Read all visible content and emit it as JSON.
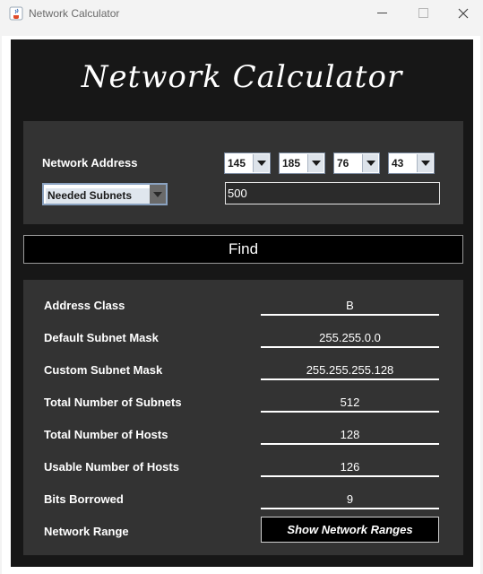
{
  "window": {
    "title": "Network Calculator",
    "icon": "java-cup-icon"
  },
  "app": {
    "heading": "Network Calculator"
  },
  "network": {
    "label": "Network Address",
    "octets": [
      "145",
      "185",
      "76",
      "43"
    ]
  },
  "mode": {
    "selected": "Needed Subnets",
    "input_value": "500"
  },
  "find_label": "Find",
  "results": [
    {
      "label": "Address Class",
      "value": "B"
    },
    {
      "label": "Default Subnet Mask",
      "value": "255.255.0.0"
    },
    {
      "label": "Custom Subnet Mask",
      "value": "255.255.255.128"
    },
    {
      "label": "Total Number of Subnets",
      "value": "512"
    },
    {
      "label": "Total Number of Hosts",
      "value": "128"
    },
    {
      "label": "Usable Number of Hosts",
      "value": "126"
    },
    {
      "label": "Bits Borrowed",
      "value": "9"
    }
  ],
  "network_range": {
    "label": "Network Range",
    "button": "Show Network Ranges"
  },
  "colors": {
    "background": "#171717",
    "panel": "#333333",
    "button": "#000000",
    "text": "#ffffff"
  }
}
